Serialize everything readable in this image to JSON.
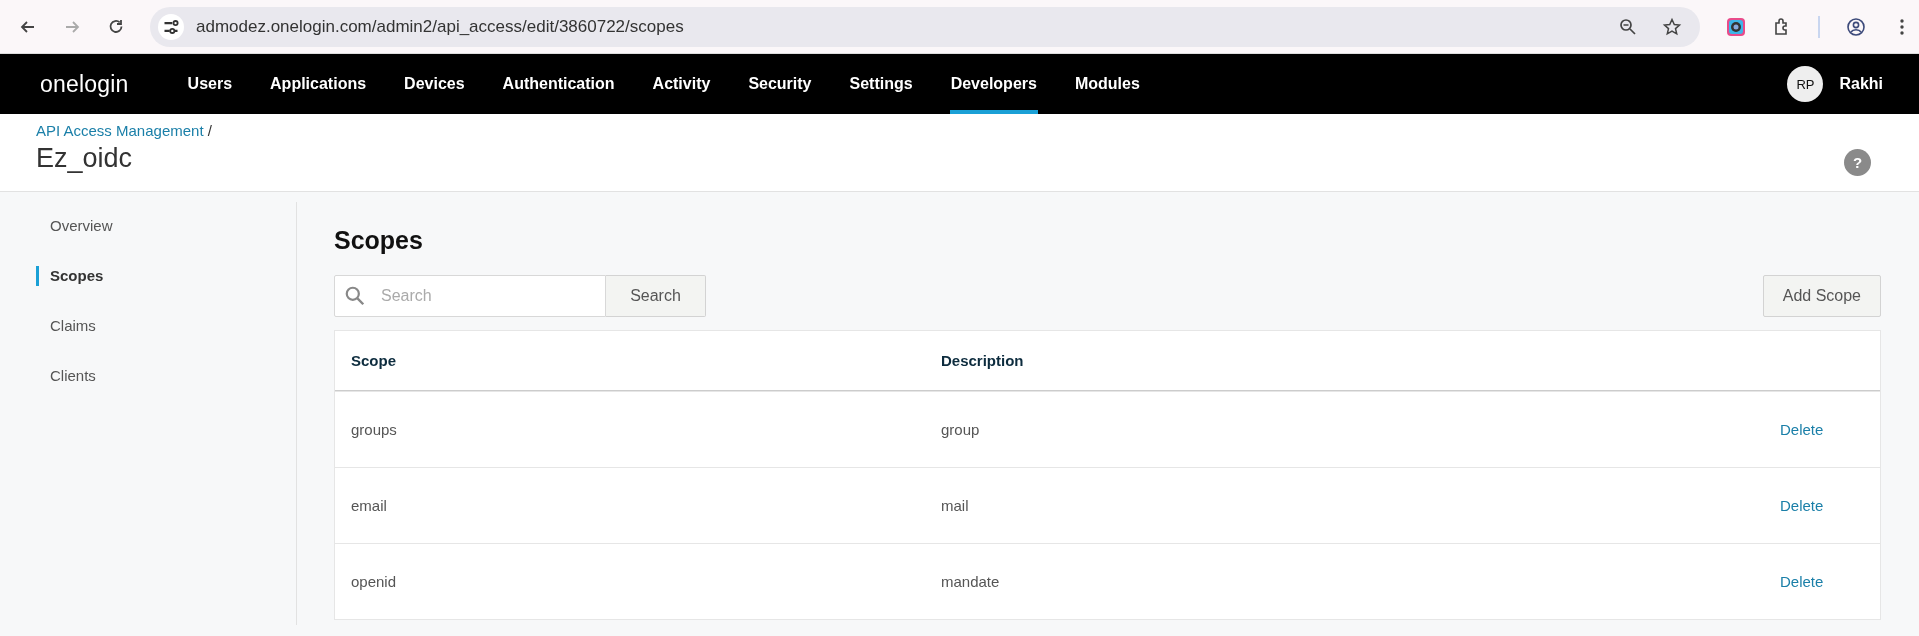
{
  "browser": {
    "url": "admodez.onelogin.com/admin2/api_access/edit/3860722/scopes"
  },
  "app_nav": {
    "logo": "onelogin",
    "items": [
      {
        "label": "Users",
        "selected": false
      },
      {
        "label": "Applications",
        "selected": false
      },
      {
        "label": "Devices",
        "selected": false
      },
      {
        "label": "Authentication",
        "selected": false
      },
      {
        "label": "Activity",
        "selected": false
      },
      {
        "label": "Security",
        "selected": false
      },
      {
        "label": "Settings",
        "selected": false
      },
      {
        "label": "Developers",
        "selected": true
      },
      {
        "label": "Modules",
        "selected": false
      }
    ],
    "user": {
      "initials": "RP",
      "name": "Rakhi"
    }
  },
  "header": {
    "breadcrumb": "API Access Management",
    "separator": "/",
    "title": "Ez_oidc",
    "help": "?"
  },
  "sidebar": {
    "items": [
      {
        "label": "Overview",
        "selected": false
      },
      {
        "label": "Scopes",
        "selected": true
      },
      {
        "label": "Claims",
        "selected": false
      },
      {
        "label": "Clients",
        "selected": false
      }
    ]
  },
  "main": {
    "heading": "Scopes",
    "search": {
      "placeholder": "Search",
      "button": "Search"
    },
    "add_button": "Add Scope",
    "table": {
      "columns": [
        "Scope",
        "Description"
      ],
      "rows": [
        {
          "scope": "groups",
          "description": "group",
          "action": "Delete"
        },
        {
          "scope": "email",
          "description": "mail",
          "action": "Delete"
        },
        {
          "scope": "openid",
          "description": "mandate",
          "action": "Delete"
        }
      ]
    }
  }
}
